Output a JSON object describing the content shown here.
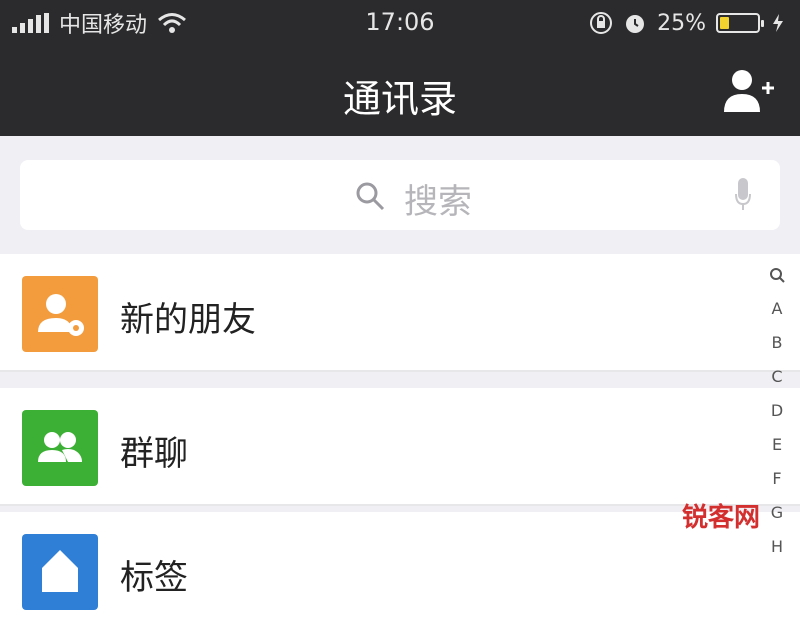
{
  "status_bar": {
    "carrier": "中国移动",
    "time": "17:06",
    "battery_percent": "25%",
    "battery_level": 0.25,
    "battery_color": "#f2d22e"
  },
  "nav": {
    "title": "通讯录",
    "add_contact_icon": "add-contact-icon"
  },
  "search": {
    "placeholder": "搜索"
  },
  "list": {
    "items": [
      {
        "label": "新的朋友",
        "icon": "new-friends-icon",
        "color": "#f39c3d"
      },
      {
        "label": "群聊",
        "icon": "group-chat-icon",
        "color": "#3cb034"
      },
      {
        "label": "标签",
        "icon": "tags-icon",
        "color": "#2f7fd6"
      }
    ]
  },
  "index_bar": {
    "letters": [
      "A",
      "B",
      "C",
      "D",
      "E",
      "F",
      "G",
      "H"
    ]
  },
  "watermark": "锐客网"
}
